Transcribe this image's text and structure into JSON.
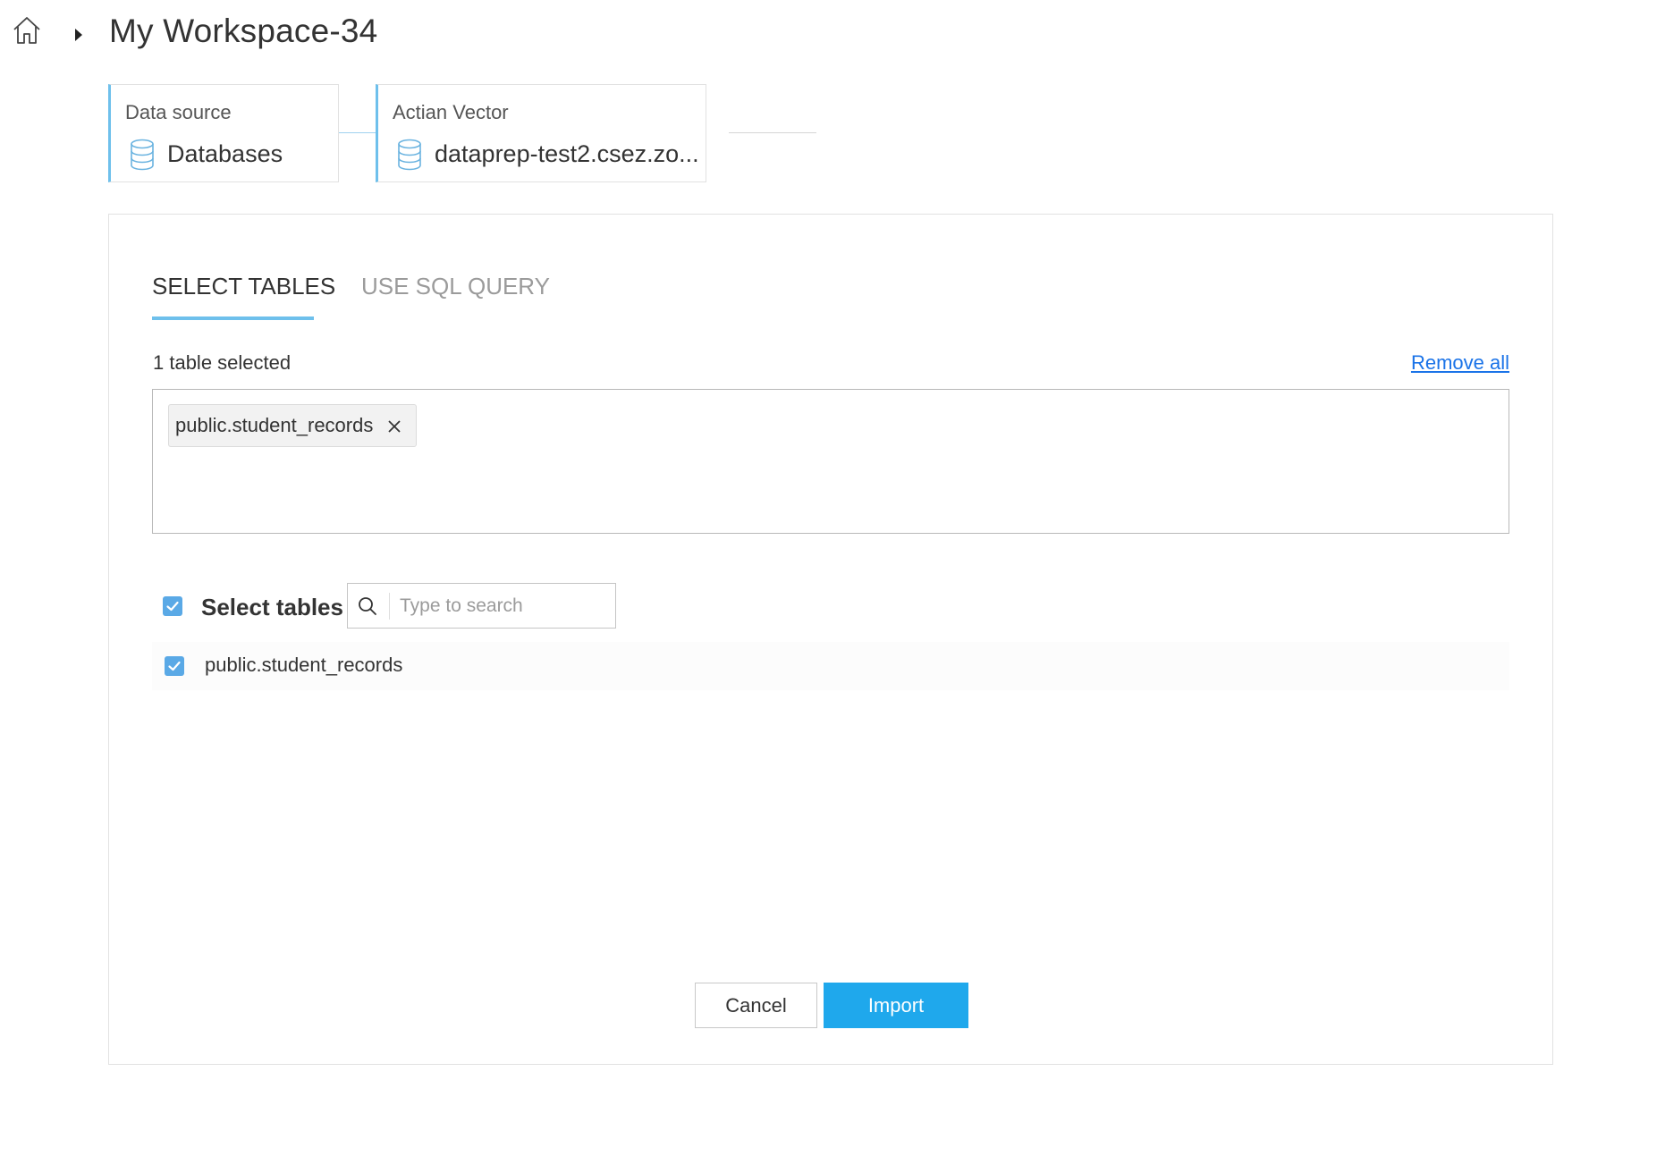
{
  "header": {
    "title": "My Workspace-34"
  },
  "pipeline": {
    "steps": [
      {
        "label": "Data source",
        "value": "Databases"
      },
      {
        "label": "Actian Vector",
        "value": "dataprep-test2.csez.zo..."
      }
    ]
  },
  "tabs": [
    {
      "label": "SELECT TABLES",
      "active": true
    },
    {
      "label": "USE SQL QUERY",
      "active": false
    }
  ],
  "selection": {
    "count_text": "1 table selected",
    "remove_all_label": "Remove all",
    "chips": [
      {
        "label": "public.student_records"
      }
    ]
  },
  "table_picker": {
    "select_all_label": "Select tables",
    "select_all_checked": true,
    "search_placeholder": "Type to search",
    "search_value": "",
    "rows": [
      {
        "label": "public.student_records",
        "checked": true
      }
    ]
  },
  "actions": {
    "cancel_label": "Cancel",
    "import_label": "Import"
  },
  "colors": {
    "accent": "#6ec0ec",
    "primary_button": "#1fa8ec",
    "checkbox": "#5aa9e6",
    "link": "#1a73e8"
  }
}
